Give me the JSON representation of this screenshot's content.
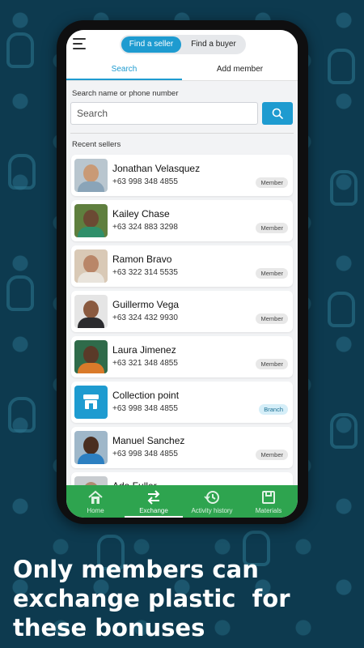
{
  "header": {
    "menu_icon": "hamburger-icon",
    "segment": {
      "active": "Find a seller",
      "inactive": "Find a buyer"
    }
  },
  "tabs": {
    "active": "Search",
    "inactive": "Add member"
  },
  "search": {
    "label": "Search name or phone number",
    "placeholder": "Search",
    "button_icon": "search-icon"
  },
  "recent": {
    "label": "Recent sellers",
    "items": [
      {
        "name": "Jonathan Velasquez",
        "phone": "+63 998 348 4855",
        "badge": "Member",
        "skin": "#c99a76",
        "shirt": "#8aa4b8",
        "bg": "#b9c6cf"
      },
      {
        "name": "Kailey Chase",
        "phone": "+63 324 883 3298",
        "badge": "Member",
        "skin": "#6b4a33",
        "shirt": "#2f8f6a",
        "bg": "#5f7f3e"
      },
      {
        "name": "Ramon Bravo",
        "phone": "+63 322 314 5535",
        "badge": "Member",
        "skin": "#b98668",
        "shirt": "#e9e4dc",
        "bg": "#d9c9b6"
      },
      {
        "name": "Guillermo Vega",
        "phone": "+63 324 432 9930",
        "badge": "Member",
        "skin": "#8a5a40",
        "shirt": "#2b2b2e",
        "bg": "#e5e5e5"
      },
      {
        "name": "Laura Jimenez",
        "phone": "+63 321 348 4855",
        "badge": "Member",
        "skin": "#5a3a28",
        "shirt": "#d97a2a",
        "bg": "#2f6b4a"
      },
      {
        "name": "Collection point",
        "phone": "+63 998 348 4855",
        "badge": "Branch",
        "branch": true
      },
      {
        "name": "Manuel Sanchez",
        "phone": "+63 998 348 4855",
        "badge": "Member",
        "skin": "#4a2e20",
        "shirt": "#2c7fc1",
        "bg": "#9fb7c9"
      },
      {
        "name": "Ada Fuller",
        "phone": "",
        "badge": "",
        "skin": "#b08a70",
        "shirt": "#999",
        "bg": "#c8ccd0"
      }
    ]
  },
  "bottom_nav": [
    {
      "label": "Home",
      "icon": "home-icon"
    },
    {
      "label": "Exchange",
      "icon": "exchange-icon",
      "active": true
    },
    {
      "label": "Activity history",
      "icon": "history-icon"
    },
    {
      "label": "Materials",
      "icon": "materials-icon"
    }
  ],
  "caption": {
    "lines": [
      "Only members can",
      "exchange plastic  for",
      "these bonuses"
    ]
  },
  "colors": {
    "accent": "#1e9bd0",
    "nav_green": "#2ea44f",
    "background": "#0d3a4f"
  }
}
